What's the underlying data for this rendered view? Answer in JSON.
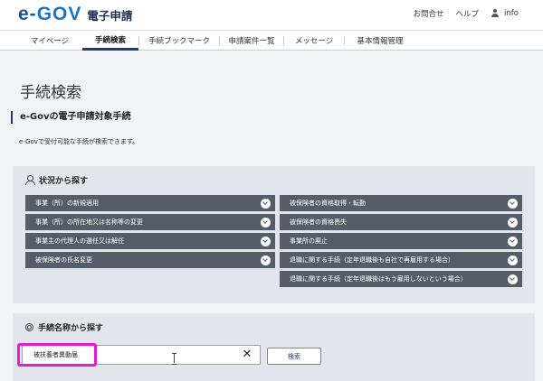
{
  "header": {
    "logo": "e-GOV",
    "logo_e": "e-",
    "logo_gov": "GOV",
    "subtitle": "電子申請",
    "links": {
      "contact": "お問合せ",
      "help": "ヘルプ",
      "user": "info"
    }
  },
  "nav": {
    "tabs": [
      {
        "label": "マイページ"
      },
      {
        "label": "手続検索",
        "active": true
      },
      {
        "label": "手続ブックマーク"
      },
      {
        "label": "申請案件一覧"
      },
      {
        "label": "メッセージ"
      },
      {
        "label": "基本情報管理"
      }
    ]
  },
  "page": {
    "title": "手続検索",
    "section_title": "e-Govの電子申請対象手続",
    "description": "e-Govで受付可能な手続が検索できます。"
  },
  "situation": {
    "heading": "状況から探す",
    "left_items": [
      "事業（所）の新規適用",
      "事業（所）の所在地又は名称等の変更",
      "事業主の代理人の選任又は解任",
      "被保険者の氏名変更"
    ],
    "right_items": [
      "被保険者の資格取得・転勤",
      "被保険者の資格喪失",
      "事業所の廃止",
      "退職に関する手続（定年退職後も自社で再雇用する場合）",
      "退職に関する手続（定年退職後はもう雇用しないという場合）"
    ]
  },
  "name_search": {
    "heading": "手続名称から探す",
    "input_value": "被扶養者異動届",
    "clear_label": "✕",
    "button_label": "検索"
  },
  "colors": {
    "accent": "#1a3d7c",
    "item_bg": "#565d69",
    "panel_bg": "#e2e6ec",
    "highlight": "#e51bd0"
  }
}
